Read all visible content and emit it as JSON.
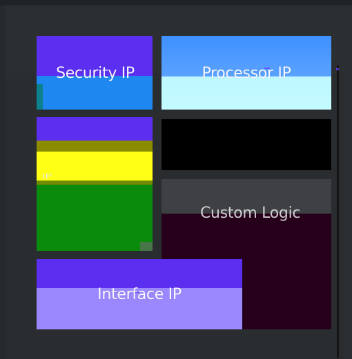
{
  "tiles": {
    "security_ip": {
      "label": "Security IP"
    },
    "processor_ip": {
      "label": "Processor IP"
    },
    "memory_ip": {
      "label": "IP"
    },
    "custom_logic": {
      "label": "Custom Logic"
    },
    "interface_ip": {
      "label": "Interface IP"
    }
  },
  "colors": {
    "background": "#2c2f31",
    "security_top": "#5b2ef0",
    "security_bottom": "#1f87f0",
    "processor_top": "#3f90ff",
    "processor_bottom": "#c3fbff",
    "memory_green": "#0a8b0b",
    "memory_yellow": "#ffff16",
    "custom_dark": "#26001a",
    "interface_top": "#5b2ef0",
    "interface_bottom": "#9b88ff",
    "black_tile": "#000000"
  }
}
